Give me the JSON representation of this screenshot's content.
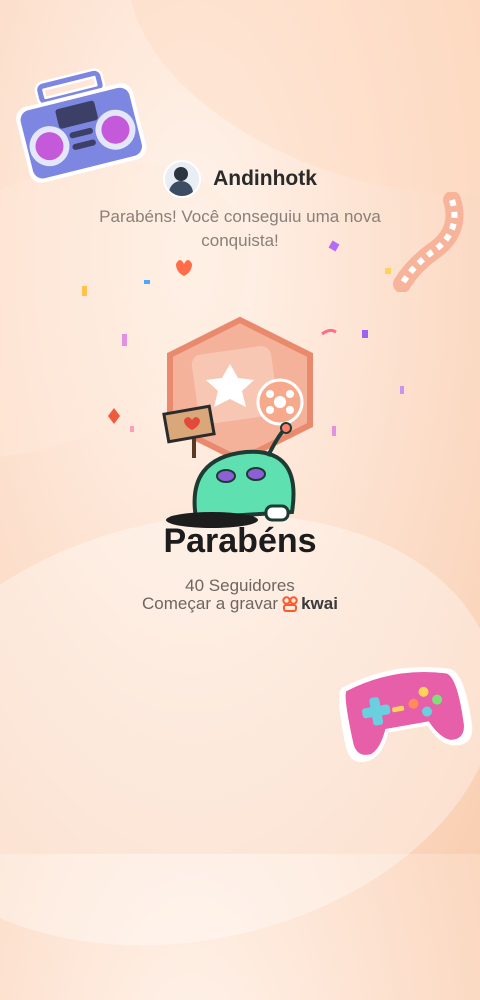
{
  "profile": {
    "username": "Andinhotk"
  },
  "message": "Parabéns! Você conseguiu uma nova conquista!",
  "achievement": {
    "title": "Parabéns",
    "followers": "40 Seguidores",
    "record_label": "Começar a gravar",
    "brand": "kwai"
  },
  "colors": {
    "background": "#fde3d2",
    "badge": "#f2a68b",
    "alien": "#5fe0b0",
    "gamepad": "#e65fa8",
    "boombox": "#7d86e0",
    "accent": "#ff5a2e"
  }
}
